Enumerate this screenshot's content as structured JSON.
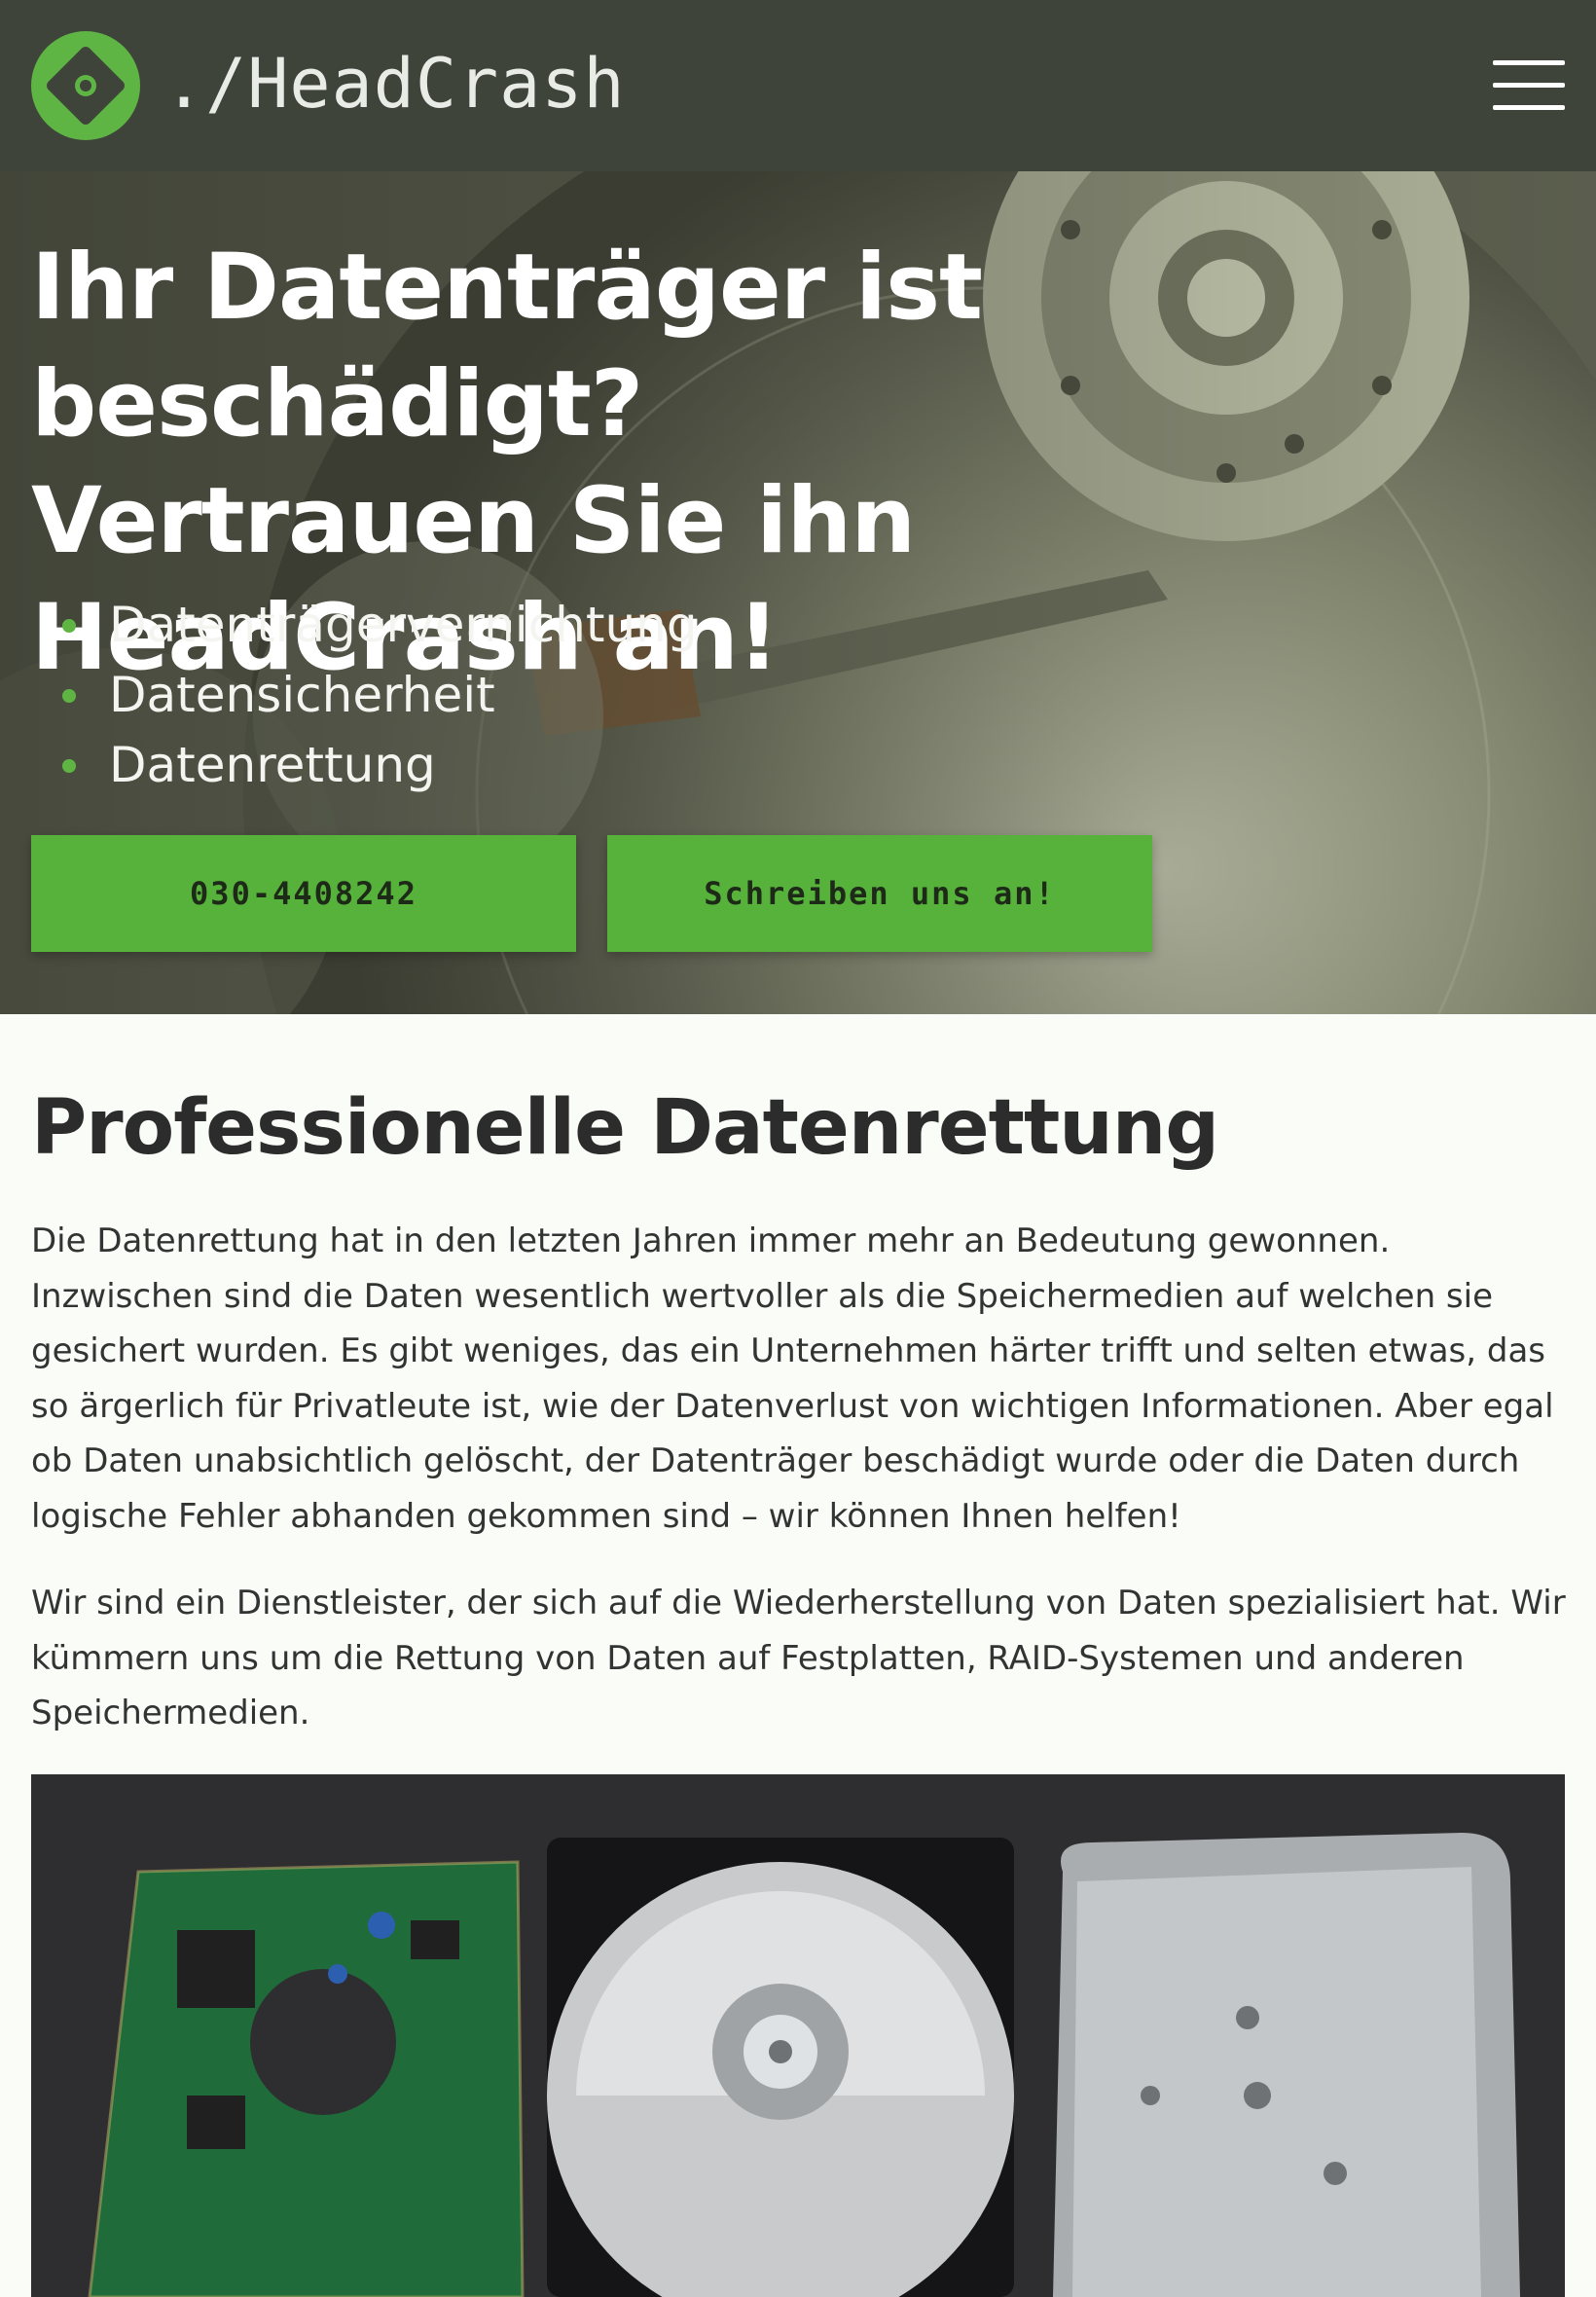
{
  "header": {
    "brand": "./HeadCrash",
    "logo_icon": "disk-diamond-logo",
    "menu_icon": "hamburger-menu-icon"
  },
  "hero": {
    "headline": "Ihr Datenträger ist beschädigt? Vertrauen Sie ihn HeadCrash an!",
    "services": [
      "Datenträgervernichtung",
      "Datensicherheit",
      "Datenrettung"
    ],
    "phone_button": "030-4408242",
    "contact_button": "Schreiben uns an!"
  },
  "main": {
    "title": "Professionelle Datenrettung",
    "paragraph_1": "Die Datenrettung hat in den letzten Jahren immer mehr an Bedeutung gewonnen. Inzwischen sind die Daten wesentlich wertvoller als die Speichermedien auf welchen sie gesichert wurden. Es gibt weniges, das ein Unternehmen härter trifft und selten etwas, das so ärgerlich für Privatleute ist, wie der Datenverlust von wichtigen Informationen. Aber egal ob Daten unabsichtlich gelöscht, der Datenträger beschädigt wurde oder die Daten durch logische Fehler abhanden gekommen sind – wir können Ihnen helfen!",
    "paragraph_2": "Wir sind ein Dienstleister, der sich auf die Wiederherstellung von Daten spezialisiert hat. Wir kümmern uns um die Rettung von Daten auf Festplatten, RAID-Systemen und anderen Speichermedien."
  },
  "colors": {
    "header_bg": "#3f443b",
    "accent_green": "#57b23c",
    "page_bg": "#fafcf7"
  }
}
